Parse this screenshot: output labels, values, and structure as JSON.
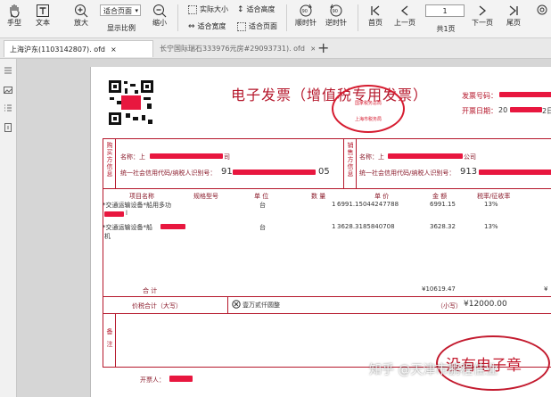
{
  "toolbar": {
    "hand": "手型",
    "text": "文本",
    "zoom_in": "放大",
    "zoom_select": "适合页面",
    "display_ratio": "显示比例",
    "zoom_out": "缩小",
    "actual_size": "实际大小",
    "fit_height": "适合高度",
    "fit_width": "适合宽度",
    "fit_page": "适合页面",
    "rotate_cw": "顺时针",
    "rotate_ccw": "逆时针",
    "first_page": "首页",
    "prev_page": "上一页",
    "page_number": "1",
    "page_total": "共1页",
    "next_page": "下一页",
    "last_page": "尾页"
  },
  "tabs": [
    {
      "label": "上海沪东(1103142807). ofd",
      "active": true
    },
    {
      "label": "长宁国际瑞石333976元房#29093731). ofd",
      "active": false
    }
  ],
  "invoice": {
    "title": "电子发票（增值税专用发票）",
    "invoice_no_label": "发票号码：",
    "issue_date_label": "开票日期：",
    "issue_date_partial": "20",
    "issue_date_suffix": "2日",
    "seal_top": "国家税务总局",
    "seal_bottom": "上海市税务局",
    "buyer_label": "购买方信息",
    "buyer_name_prefix": "名称：上",
    "buyer_name_suffix": "司",
    "buyer_tax_label": "统一社会信用代码/纳税人识别号：",
    "buyer_tax_start": "91",
    "buyer_tax_end": "05",
    "seller_label": "销售方信息",
    "seller_name_prefix": "名称：上",
    "seller_name_suffix": "公司",
    "seller_tax_label": "统一社会信用代码/纳税人识别号：",
    "seller_tax_start": "913",
    "columns": [
      "项目名称",
      "规格型号",
      "单 位",
      "数 量",
      "单 价",
      "金 额",
      "税率/征收率"
    ],
    "items": [
      {
        "name": "*交通运输设备*船用多功",
        "name2": "l",
        "unit": "台",
        "qty": "1",
        "price": "6991.15044247788",
        "amount": "6991.15",
        "rate": "13%"
      },
      {
        "name": "*交通运输设备*船",
        "name2": "机",
        "unit": "台",
        "qty": "1",
        "price": "3628.3185840708",
        "amount": "3628.32",
        "rate": "13%"
      }
    ],
    "total_label": "合 计",
    "total_amount": "¥10619.47",
    "total_tax": "¥",
    "grand_label": "价税合计（大写）",
    "grand_words": "壹万贰仟圆整",
    "small_label": "（小写）",
    "grand_number": "¥12000.00",
    "remarks_label": "备注",
    "drawer_label": "开票人：",
    "annotation": "没有电子章",
    "watermark": "知乎 @天津市鹏程佳业"
  },
  "colors": {
    "invoice_red": "#b5172b",
    "redaction": "#e8173f",
    "seal": "#d61c30"
  }
}
